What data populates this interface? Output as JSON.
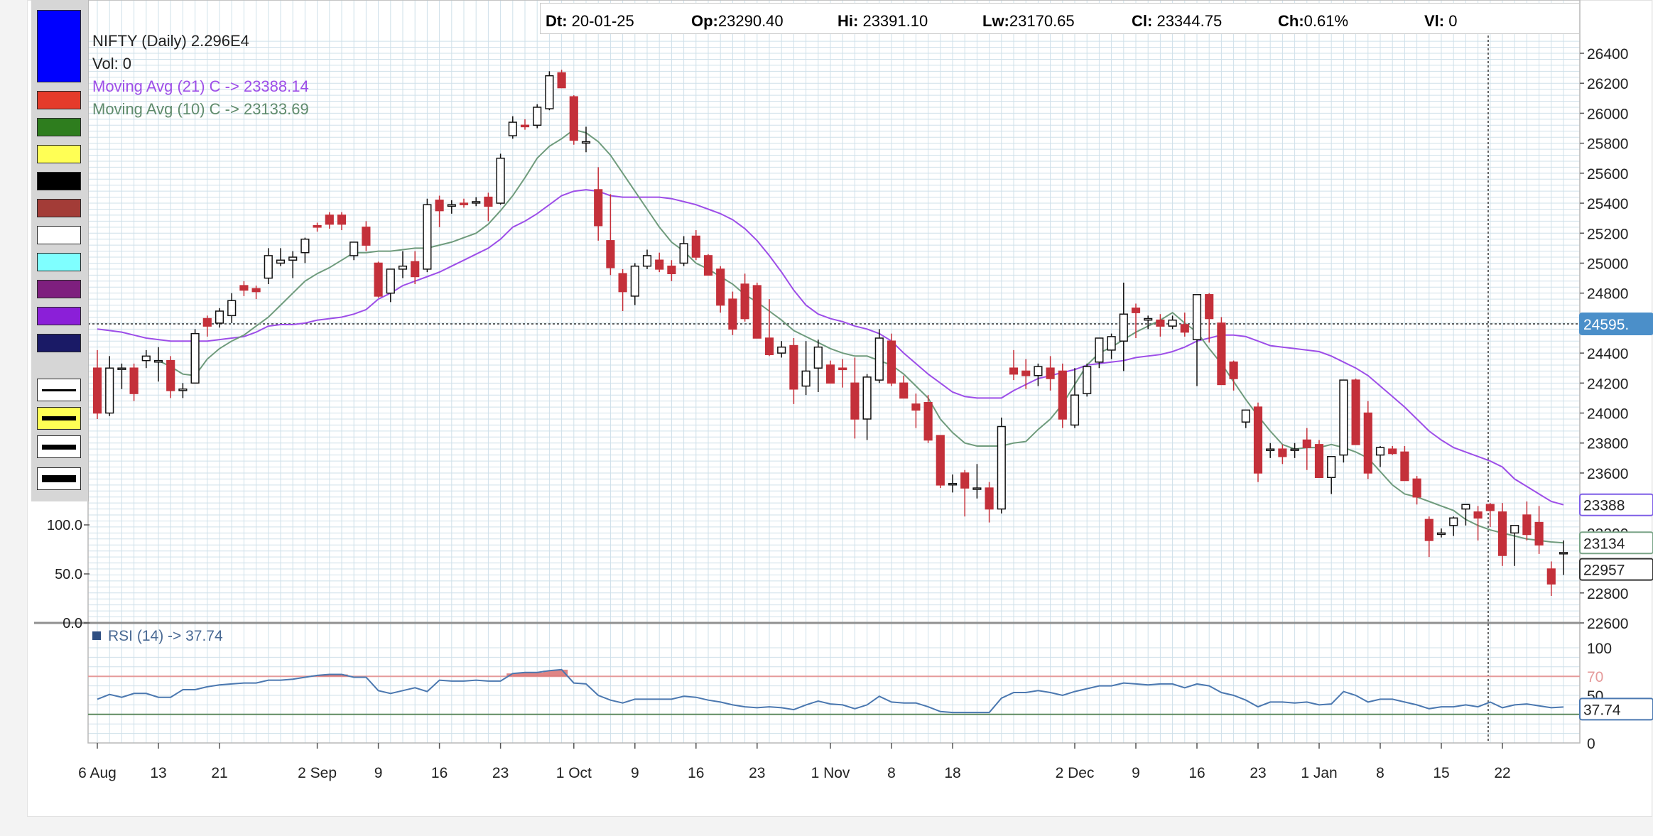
{
  "ohlc": {
    "dt_label": "Dt:",
    "dt": "20-01-25",
    "op_label": "Op:",
    "op": "23290.40",
    "hi_label": "Hi:",
    "hi": "23391.10",
    "lw_label": "Lw:",
    "lw": "23170.65",
    "cl_label": "Cl:",
    "cl": "23344.75",
    "ch_label": "Ch:",
    "ch": "0.61%",
    "vl_label": "Vl:",
    "vl": "0"
  },
  "info": {
    "title": "NIFTY (Daily) 2.296E4",
    "volume": "Vol: 0",
    "ma21": "Moving Avg (21) C -> 23388.14",
    "ma10": "Moving Avg (10) C -> 23133.69"
  },
  "rsi_label": "RSI (14) -> 37.74",
  "palette": {
    "colors": [
      "#0000ff",
      "#e53b2a",
      "#2e7d1e",
      "#ffff55",
      "#000000",
      "#a33c37",
      "#ffffff",
      "#7fffff",
      "#7e1f7e",
      "#8b1fd8",
      "#1a1a66"
    ],
    "line_styles": [
      "thin",
      "thin-yellow",
      "medium",
      "thick"
    ]
  },
  "colors": {
    "up_candle": "#ffffff",
    "down_candle": "#c4303a",
    "ma21": "#9d4ee8",
    "ma10": "#6f9b7c",
    "rsi": "#4b78b0",
    "rsi_overbought": "#e59a9a",
    "rsi_oversold": "#5f8a60",
    "grid": "#cfe0ea",
    "axis_box": "#7e5ee6"
  },
  "chart_data": {
    "type": "candlestick",
    "title": "NIFTY (Daily)",
    "ylim": [
      22600,
      26500
    ],
    "yticks": [
      22600,
      22800,
      23000,
      23200,
      23400,
      23600,
      23800,
      24000,
      24200,
      24400,
      24600,
      24800,
      25000,
      25200,
      25400,
      25600,
      25800,
      26000,
      26200,
      26400
    ],
    "ytick_labels": [
      "22600",
      "22800",
      "23000",
      "23200",
      "23400",
      "23600",
      "23800",
      "24000",
      "24200",
      "24400",
      "24600",
      "24800",
      "25000",
      "25200",
      "25400",
      "25600",
      "25800",
      "26000",
      "26200",
      "26400"
    ],
    "xtick_labels": [
      {
        "label": "6 Aug",
        "idx": 0
      },
      {
        "label": "13",
        "idx": 5
      },
      {
        "label": "21",
        "idx": 10
      },
      {
        "label": "2 Sep",
        "idx": 18
      },
      {
        "label": "9",
        "idx": 23
      },
      {
        "label": "16",
        "idx": 28
      },
      {
        "label": "23",
        "idx": 33
      },
      {
        "label": "1 Oct",
        "idx": 39
      },
      {
        "label": "9",
        "idx": 44
      },
      {
        "label": "16",
        "idx": 49
      },
      {
        "label": "23",
        "idx": 54
      },
      {
        "label": "1 Nov",
        "idx": 60
      },
      {
        "label": "8",
        "idx": 65
      },
      {
        "label": "18",
        "idx": 70
      },
      {
        "label": "2 Dec",
        "idx": 80
      },
      {
        "label": "9",
        "idx": 85
      },
      {
        "label": "16",
        "idx": 90
      },
      {
        "label": "23",
        "idx": 95
      },
      {
        "label": "1 Jan",
        "idx": 100
      },
      {
        "label": "8",
        "idx": 105
      },
      {
        "label": "15",
        "idx": 110
      },
      {
        "label": "22",
        "idx": 115
      }
    ],
    "candles": [
      [
        24300,
        24420,
        23960,
        24000
      ],
      [
        24000,
        24380,
        23980,
        24300
      ],
      [
        24300,
        24330,
        24160,
        24300
      ],
      [
        24300,
        24330,
        24080,
        24130
      ],
      [
        24350,
        24420,
        24300,
        24380
      ],
      [
        24340,
        24440,
        24210,
        24350
      ],
      [
        24350,
        24380,
        24100,
        24150
      ],
      [
        24150,
        24200,
        24100,
        24160
      ],
      [
        24200,
        24560,
        24200,
        24530
      ],
      [
        24630,
        24650,
        24510,
        24580
      ],
      [
        24600,
        24700,
        24570,
        24680
      ],
      [
        24650,
        24800,
        24600,
        24750
      ],
      [
        24850,
        24880,
        24780,
        24820
      ],
      [
        24830,
        24850,
        24760,
        24810
      ],
      [
        24900,
        25100,
        24860,
        25050
      ],
      [
        25000,
        25100,
        24980,
        25020
      ],
      [
        25020,
        25080,
        24900,
        25040
      ],
      [
        25070,
        25170,
        25000,
        25160
      ],
      [
        25250,
        25270,
        25210,
        25240
      ],
      [
        25320,
        25340,
        25230,
        25260
      ],
      [
        25320,
        25340,
        25220,
        25260
      ],
      [
        25050,
        25130,
        25020,
        25140
      ],
      [
        25240,
        25280,
        25080,
        25120
      ],
      [
        25000,
        25010,
        24770,
        24780
      ],
      [
        24800,
        24900,
        24740,
        24960
      ],
      [
        24960,
        25080,
        24900,
        24980
      ],
      [
        25010,
        25080,
        24860,
        24910
      ],
      [
        24960,
        25430,
        24940,
        25390
      ],
      [
        25420,
        25450,
        25240,
        25350
      ],
      [
        25380,
        25420,
        25330,
        25390
      ],
      [
        25400,
        25430,
        25370,
        25390
      ],
      [
        25410,
        25440,
        25380,
        25410
      ],
      [
        25440,
        25470,
        25280,
        25380
      ],
      [
        25400,
        25730,
        25390,
        25700
      ],
      [
        25850,
        25980,
        25830,
        25940
      ],
      [
        25920,
        25960,
        25890,
        25910
      ],
      [
        25920,
        26060,
        25900,
        26040
      ],
      [
        26030,
        26280,
        26020,
        26250
      ],
      [
        26270,
        26290,
        26170,
        26170
      ],
      [
        26110,
        26120,
        25790,
        25820
      ],
      [
        25810,
        25910,
        25740,
        25810
      ],
      [
        25490,
        25640,
        25150,
        25250
      ],
      [
        25150,
        25460,
        24920,
        24970
      ],
      [
        24930,
        24960,
        24680,
        24810
      ],
      [
        24780,
        25000,
        24720,
        24980
      ],
      [
        24980,
        25090,
        24960,
        25050
      ],
      [
        25020,
        25070,
        24940,
        24960
      ],
      [
        24980,
        25020,
        24880,
        24930
      ],
      [
        25000,
        25180,
        24980,
        25130
      ],
      [
        25180,
        25220,
        25020,
        25040
      ],
      [
        25050,
        25060,
        24930,
        24920
      ],
      [
        24960,
        24980,
        24670,
        24720
      ],
      [
        24760,
        24810,
        24520,
        24560
      ],
      [
        24860,
        24930,
        24610,
        24630
      ],
      [
        24850,
        24870,
        24550,
        24500
      ],
      [
        24500,
        24760,
        24380,
        24390
      ],
      [
        24400,
        24480,
        24370,
        24440
      ],
      [
        24450,
        24500,
        24060,
        24160
      ],
      [
        24180,
        24480,
        24120,
        24280
      ],
      [
        24300,
        24490,
        24140,
        24440
      ],
      [
        24320,
        24350,
        24220,
        24200
      ],
      [
        24300,
        24360,
        24170,
        24290
      ],
      [
        24200,
        24370,
        23830,
        23960
      ],
      [
        23960,
        24260,
        23820,
        24240
      ],
      [
        24220,
        24560,
        24200,
        24500
      ],
      [
        24480,
        24530,
        24180,
        24200
      ],
      [
        24200,
        24250,
        24150,
        24100
      ],
      [
        24060,
        24130,
        23900,
        24020
      ],
      [
        24070,
        24120,
        23800,
        23820
      ],
      [
        23850,
        23850,
        23500,
        23520
      ],
      [
        23530,
        23590,
        23470,
        23530
      ],
      [
        23600,
        23620,
        23310,
        23500
      ],
      [
        23500,
        23660,
        23430,
        23500
      ],
      [
        23500,
        23540,
        23270,
        23360
      ],
      [
        23360,
        23970,
        23330,
        23910
      ],
      [
        24300,
        24420,
        24220,
        24260
      ],
      [
        24280,
        24360,
        24160,
        24250
      ],
      [
        24250,
        24330,
        24180,
        24310
      ],
      [
        24300,
        24380,
        24150,
        24230
      ],
      [
        24280,
        24330,
        23900,
        23960
      ],
      [
        23920,
        24300,
        23900,
        24120
      ],
      [
        24130,
        24330,
        24110,
        24310
      ],
      [
        24340,
        24500,
        24300,
        24500
      ],
      [
        24420,
        24530,
        24360,
        24510
      ],
      [
        24480,
        24870,
        24280,
        24660
      ],
      [
        24700,
        24730,
        24500,
        24670
      ],
      [
        24620,
        24650,
        24560,
        24630
      ],
      [
        24620,
        24660,
        24510,
        24580
      ],
      [
        24580,
        24650,
        24560,
        24620
      ],
      [
        24590,
        24670,
        24510,
        24540
      ],
      [
        24490,
        24780,
        24180,
        24790
      ],
      [
        24790,
        24800,
        24470,
        24630
      ],
      [
        24600,
        24640,
        24210,
        24190
      ],
      [
        24340,
        24350,
        24150,
        24230
      ],
      [
        23940,
        24010,
        23900,
        24020
      ],
      [
        24040,
        24070,
        23540,
        23600
      ],
      [
        23750,
        23800,
        23700,
        23760
      ],
      [
        23760,
        23790,
        23660,
        23710
      ],
      [
        23760,
        23800,
        23700,
        23760
      ],
      [
        23820,
        23900,
        23620,
        23770
      ],
      [
        23790,
        23820,
        23650,
        23570
      ],
      [
        23570,
        23610,
        23460,
        23710
      ],
      [
        23720,
        24200,
        23670,
        24220
      ],
      [
        24220,
        24230,
        23880,
        23790
      ],
      [
        24000,
        24080,
        23560,
        23600
      ],
      [
        23720,
        23780,
        23640,
        23770
      ],
      [
        23760,
        23780,
        23720,
        23730
      ],
      [
        23740,
        23780,
        23560,
        23550
      ],
      [
        23560,
        23580,
        23390,
        23440
      ],
      [
        23290,
        23310,
        23040,
        23150
      ],
      [
        23200,
        23230,
        23170,
        23200
      ],
      [
        23250,
        23310,
        23180,
        23300
      ],
      [
        23360,
        23390,
        23250,
        23390
      ],
      [
        23340,
        23380,
        23150,
        23300
      ],
      [
        23390,
        23400,
        23240,
        23350
      ],
      [
        23340,
        23400,
        22980,
        23050
      ],
      [
        23200,
        23210,
        22980,
        23250
      ],
      [
        23320,
        23410,
        23150,
        23190
      ],
      [
        23270,
        23380,
        23060,
        23120
      ],
      [
        22960,
        23010,
        22780,
        22860
      ],
      [
        23070,
        23150,
        22920,
        23070
      ]
    ],
    "ma21_values": [
      24560,
      24550,
      24540,
      24520,
      24500,
      24490,
      24480,
      24480,
      24480,
      24480,
      24490,
      24500,
      24510,
      24540,
      24580,
      24590,
      24590,
      24600,
      24620,
      24630,
      24640,
      24660,
      24690,
      24760,
      24800,
      24850,
      24880,
      24910,
      24940,
      24980,
      25020,
      25060,
      25100,
      25160,
      25240,
      25280,
      25330,
      25390,
      25450,
      25480,
      25490,
      25480,
      25450,
      25440,
      25440,
      25440,
      25440,
      25430,
      25410,
      25390,
      25360,
      25330,
      25290,
      25230,
      25150,
      25050,
      24940,
      24820,
      24720,
      24660,
      24630,
      24610,
      24580,
      24560,
      24530,
      24480,
      24400,
      24330,
      24260,
      24200,
      24140,
      24110,
      24100,
      24100,
      24100,
      24150,
      24190,
      24230,
      24250,
      24270,
      24290,
      24320,
      24330,
      24340,
      24350,
      24370,
      24380,
      24390,
      24410,
      24440,
      24480,
      24500,
      24520,
      24520,
      24510,
      24480,
      24450,
      24440,
      24430,
      24420,
      24410,
      24380,
      24340,
      24300,
      24250,
      24180,
      24110,
      24040,
      23960,
      23880,
      23820,
      23770,
      23740,
      23710,
      23680,
      23640,
      23560,
      23510,
      23460,
      23410,
      23388
    ],
    "ma10_values": [
      null,
      null,
      null,
      null,
      null,
      24350,
      24310,
      24260,
      24250,
      24360,
      24430,
      24480,
      24520,
      24580,
      24640,
      24720,
      24800,
      24880,
      24930,
      24970,
      25020,
      25070,
      25070,
      25080,
      25080,
      25090,
      25100,
      25100,
      25120,
      25140,
      25170,
      25200,
      25260,
      25350,
      25450,
      25570,
      25700,
      25780,
      25830,
      25890,
      25870,
      25810,
      25720,
      25600,
      25480,
      25360,
      25240,
      25140,
      25080,
      25000,
      24960,
      24910,
      24860,
      24790,
      24740,
      24680,
      24620,
      24550,
      24510,
      24470,
      24430,
      24400,
      24380,
      24380,
      24350,
      24320,
      24260,
      24180,
      24100,
      23960,
      23870,
      23800,
      23780,
      23780,
      23780,
      23800,
      23810,
      23890,
      23960,
      24060,
      24190,
      24320,
      24400,
      24440,
      24490,
      24540,
      24580,
      24620,
      24670,
      24600,
      24540,
      24430,
      24330,
      24210,
      24090,
      23980,
      23880,
      23790,
      23760,
      23770,
      23770,
      23790,
      23770,
      23740,
      23700,
      23610,
      23520,
      23460,
      23440,
      23410,
      23380,
      23350,
      23290,
      23250,
      23220,
      23200,
      23180,
      23160,
      23150,
      23140,
      23134
    ],
    "rsi": {
      "name": "RSI (14)",
      "overbought": 70,
      "oversold": 30,
      "yticks": [
        0,
        50,
        100
      ],
      "ytick_labels": [
        "0",
        "50",
        "100"
      ],
      "values": [
        46,
        51,
        48,
        52,
        52,
        48,
        48,
        56,
        56,
        59,
        61,
        62,
        63,
        63,
        66,
        66,
        67,
        69,
        71,
        72,
        72,
        69,
        69,
        55,
        52,
        55,
        58,
        54,
        66,
        65,
        65,
        66,
        65,
        65,
        73,
        74,
        74,
        76,
        77,
        63,
        62,
        50,
        45,
        42,
        46,
        46,
        46,
        46,
        49,
        48,
        45,
        43,
        40,
        38,
        37,
        38,
        37,
        35,
        40,
        44,
        41,
        40,
        36,
        40,
        49,
        43,
        42,
        42,
        38,
        33,
        32,
        32,
        32,
        32,
        47,
        53,
        53,
        55,
        53,
        50,
        54,
        57,
        60,
        60,
        63,
        62,
        61,
        62,
        62,
        58,
        62,
        60,
        53,
        50,
        45,
        38,
        43,
        43,
        42,
        43,
        40,
        41,
        54,
        50,
        43,
        46,
        46,
        43,
        40,
        36,
        38,
        38,
        40,
        38,
        43,
        37,
        40,
        41,
        39,
        37,
        37.74
      ]
    },
    "right_labels": {
      "crosshair_price": "24595.",
      "ma21": "23388",
      "ma10": "23134",
      "last": "22957",
      "rsi_last": "37.74",
      "ob": "70",
      "os": "50"
    },
    "lower_axis_labels": [
      "100.0",
      "50.0",
      "0.0"
    ]
  }
}
